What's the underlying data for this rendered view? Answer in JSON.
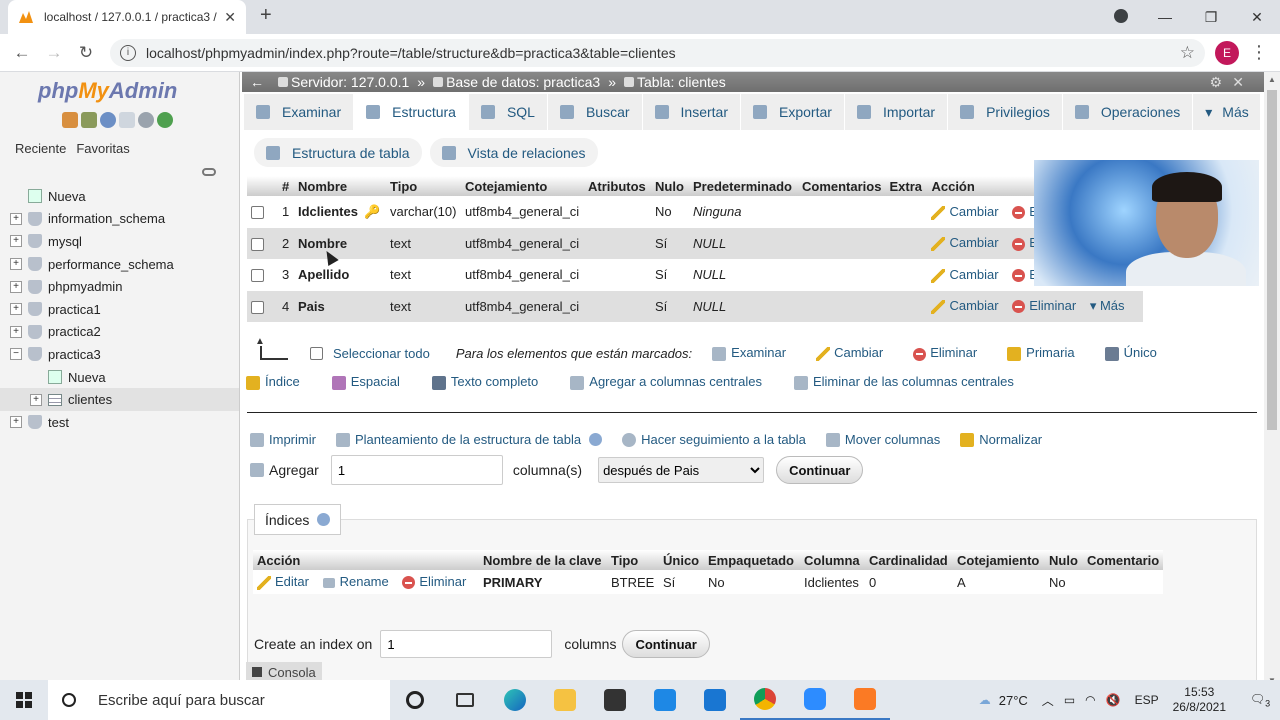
{
  "browser": {
    "tab_title": "localhost / 127.0.0.1 / practica3 /",
    "new_tab": "+",
    "url": "localhost/phpmyadmin/index.php?route=/table/structure&db=practica3&table=clientes",
    "avatar_letter": "E",
    "win_minimize": "—",
    "win_restore": "❐",
    "win_close": "✕"
  },
  "sidebar": {
    "logo": {
      "php": "php",
      "my": "My",
      "admin": "Admin"
    },
    "tab_recent": "Reciente",
    "tab_favorites": "Favoritas",
    "items": [
      {
        "label": "Nueva",
        "kind": "new"
      },
      {
        "label": "information_schema",
        "kind": "db"
      },
      {
        "label": "mysql",
        "kind": "db"
      },
      {
        "label": "performance_schema",
        "kind": "db"
      },
      {
        "label": "phpmyadmin",
        "kind": "db"
      },
      {
        "label": "practica1",
        "kind": "db"
      },
      {
        "label": "practica2",
        "kind": "db"
      },
      {
        "label": "practica3",
        "kind": "db-open"
      },
      {
        "label": "Nueva",
        "kind": "child-new"
      },
      {
        "label": "clientes",
        "kind": "child-table"
      },
      {
        "label": "test",
        "kind": "db"
      }
    ]
  },
  "breadcrumb": {
    "server": "Servidor: 127.0.0.1",
    "database": "Base de datos: practica3",
    "table": "Tabla: clientes",
    "sep": "»"
  },
  "menu": {
    "tabs": [
      "Examinar",
      "Estructura",
      "SQL",
      "Buscar",
      "Insertar",
      "Exportar",
      "Importar",
      "Privilegios",
      "Operaciones",
      "Más"
    ],
    "active": "Estructura"
  },
  "subtabs": {
    "table_structure": "Estructura de tabla",
    "relations": "Vista de relaciones"
  },
  "structure": {
    "headers": [
      "#",
      "Nombre",
      "Tipo",
      "Cotejamiento",
      "Atributos",
      "Nulo",
      "Predeterminado",
      "Comentarios",
      "Extra",
      "Acción"
    ],
    "rows": [
      {
        "num": "1",
        "name": "Idclientes",
        "type": "varchar(10)",
        "collation": "utf8mb4_general_ci",
        "attributes": "",
        "null": "No",
        "default": "Ninguna",
        "comments": "",
        "extra": ""
      },
      {
        "num": "2",
        "name": "Nombre",
        "type": "text",
        "collation": "utf8mb4_general_ci",
        "attributes": "",
        "null": "Sí",
        "default": "NULL",
        "comments": "",
        "extra": ""
      },
      {
        "num": "3",
        "name": "Apellido",
        "type": "text",
        "collation": "utf8mb4_general_ci",
        "attributes": "",
        "null": "Sí",
        "default": "NULL",
        "comments": "",
        "extra": ""
      },
      {
        "num": "4",
        "name": "Pais",
        "type": "text",
        "collation": "utf8mb4_general_ci",
        "attributes": "",
        "null": "Sí",
        "default": "NULL",
        "comments": "",
        "extra": ""
      }
    ],
    "action_change": "Cambiar",
    "action_delete": "Eliminar",
    "action_more": "Más"
  },
  "bulk": {
    "select_all": "Seleccionar todo",
    "for_marked": "Para los elementos que están marcados:",
    "browse": "Examinar",
    "change": "Cambiar",
    "delete": "Eliminar",
    "primary": "Primaria",
    "unique": "Único",
    "index": "Índice",
    "spatial": "Espacial",
    "fulltext": "Texto completo",
    "add_central": "Agregar a columnas centrales",
    "remove_central": "Eliminar de las columnas centrales"
  },
  "tools": {
    "print": "Imprimir",
    "propose": "Planteamiento de la estructura de tabla",
    "track": "Hacer seguimiento a la tabla",
    "move": "Mover columnas",
    "normalize": "Normalizar"
  },
  "add_columns": {
    "label": "Agregar",
    "count": "1",
    "unit": "columna(s)",
    "position": "después de Pais",
    "button": "Continuar"
  },
  "indexes": {
    "legend": "Índices",
    "headers": [
      "Acción",
      "Nombre de la clave",
      "Tipo",
      "Único",
      "Empaquetado",
      "Columna",
      "Cardinalidad",
      "Cotejamiento",
      "Nulo",
      "Comentario"
    ],
    "row": {
      "edit": "Editar",
      "rename": "Rename",
      "delete": "Eliminar",
      "key_name": "PRIMARY",
      "type": "BTREE",
      "unique": "Sí",
      "packed": "No",
      "column": "Idclientes",
      "cardinality": "0",
      "collation": "A",
      "null": "No",
      "comment": ""
    },
    "create_label": "Create an index on",
    "create_count": "1",
    "create_unit": "columns",
    "create_button": "Continuar"
  },
  "console": "Consola",
  "taskbar": {
    "search_placeholder": "Escribe aquí para buscar",
    "temperature": "27°C",
    "language": "ESP",
    "time": "15:53",
    "date": "26/8/2021",
    "notifications": "3"
  }
}
